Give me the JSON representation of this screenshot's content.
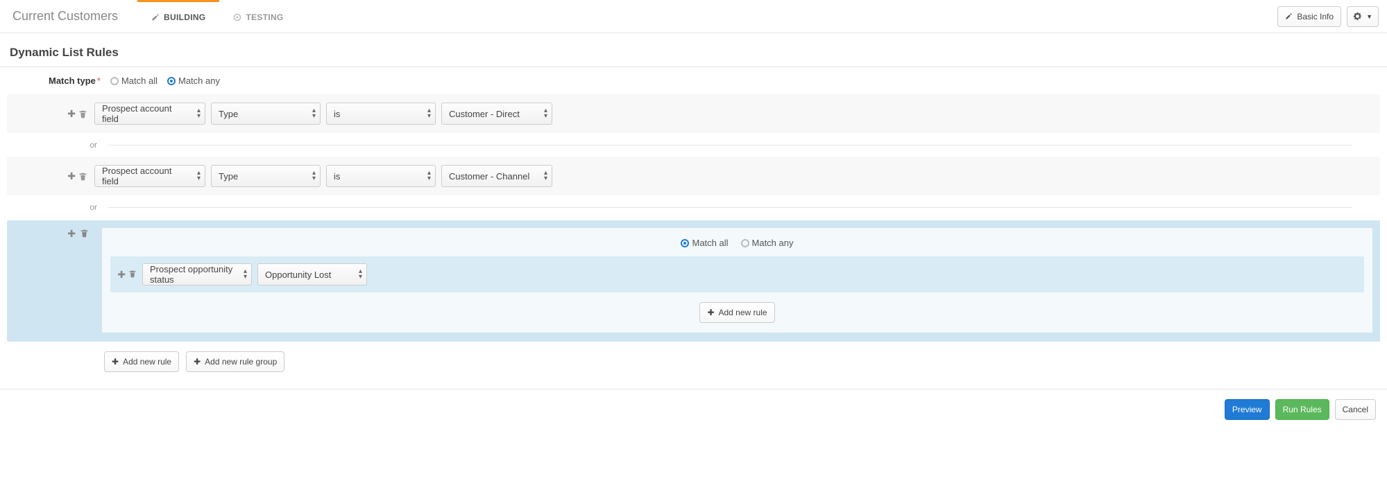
{
  "title": "Current Customers",
  "tabs": {
    "building": "BUILDING",
    "testing": "TESTING"
  },
  "header": {
    "basic_info": "Basic Info"
  },
  "section": {
    "title": "Dynamic List Rules"
  },
  "match": {
    "label": "Match type",
    "all": "Match all",
    "any": "Match any"
  },
  "rules": [
    {
      "field": "Prospect account field",
      "attr": "Type",
      "op": "is",
      "value": "Customer - Direct"
    },
    {
      "field": "Prospect account field",
      "attr": "Type",
      "op": "is",
      "value": "Customer - Channel"
    }
  ],
  "separator": "or",
  "group": {
    "match_all": "Match all",
    "match_any": "Match any",
    "rule": {
      "field": "Prospect opportunity status",
      "value": "Opportunity Lost"
    },
    "add_rule": "Add new rule"
  },
  "bottom": {
    "add_rule": "Add new rule",
    "add_group": "Add new rule group"
  },
  "footer": {
    "preview": "Preview",
    "run": "Run Rules",
    "cancel": "Cancel"
  }
}
